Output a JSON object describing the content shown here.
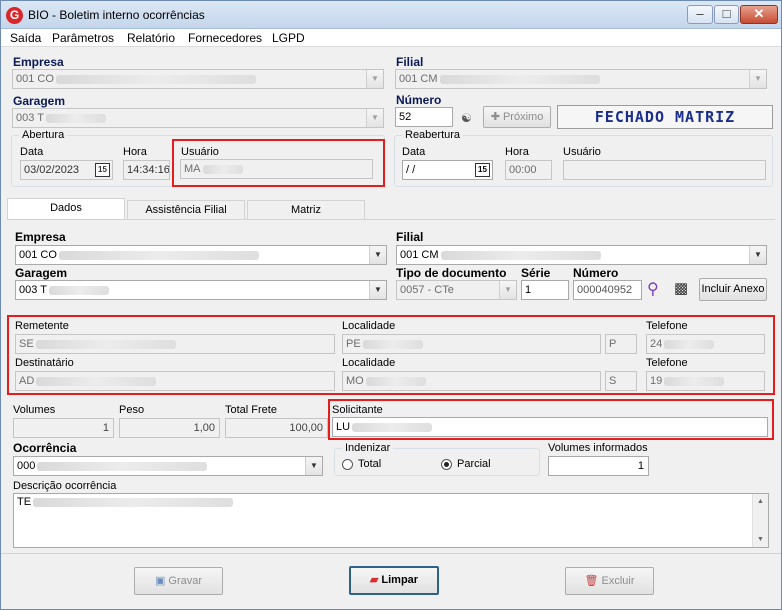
{
  "window": {
    "title": "BIO - Boletim interno ocorrências",
    "icon_letter": "G"
  },
  "menu": [
    "Saída",
    "Parâmetros",
    "Relatório",
    "Fornecedores",
    "LGPD"
  ],
  "header": {
    "empresa_label": "Empresa",
    "empresa_value": "001 CO",
    "filial_label": "Filial",
    "filial_value": "001 CM",
    "garagem_label": "Garagem",
    "garagem_value": "003 T",
    "numero_label": "Número",
    "numero_value": "52",
    "proximo_label": "Próximo",
    "status_text": "FECHADO MATRIZ"
  },
  "abertura": {
    "group_title": "Abertura",
    "data_label": "Data",
    "data_value": "03/02/2023",
    "hora_label": "Hora",
    "hora_value": "14:34:16",
    "usuario_label": "Usuário",
    "usuario_value": "MA"
  },
  "reabertura": {
    "group_title": "Reabertura",
    "data_label": "Data",
    "data_value": " /  /",
    "hora_label": "Hora",
    "hora_value": "00:00",
    "usuario_label": "Usuário",
    "usuario_value": ""
  },
  "calendar_icon_text": "15",
  "tabs": [
    "Dados",
    "Assistência Filial",
    "Matriz"
  ],
  "dados": {
    "empresa_label": "Empresa",
    "empresa_value": "001 CO",
    "filial_label": "Filial",
    "filial_value": "001 CM",
    "garagem_label": "Garagem",
    "garagem_value": "003 T",
    "tipo_doc_label": "Tipo de documento",
    "tipo_doc_value": "0057 - CTe",
    "serie_label": "Série",
    "serie_value": "1",
    "numero_label": "Número",
    "numero_value": "000040952",
    "incluir_anexo_label": "Incluir Anexo",
    "remetente_label": "Remetente",
    "remetente_value": "SE",
    "rem_localidade_label": "Localidade",
    "rem_localidade_value": "PE",
    "rem_uf_value": "P",
    "rem_telefone_label": "Telefone",
    "rem_telefone_value": "24",
    "destinatario_label": "Destinatário",
    "destinatario_value": "AD",
    "dest_localidade_label": "Localidade",
    "dest_localidade_value": "MO",
    "dest_uf_value": "S",
    "dest_telefone_label": "Telefone",
    "dest_telefone_value": "19",
    "volumes_label": "Volumes",
    "volumes_value": "1",
    "peso_label": "Peso",
    "peso_value": "1,00",
    "total_frete_label": "Total Frete",
    "total_frete_value": "100,00",
    "solicitante_label": "Solicitante",
    "solicitante_value": "LU",
    "ocorrencia_label": "Ocorrência",
    "ocorrencia_value": "000",
    "indenizar_title": "Indenizar",
    "indenizar_total": "Total",
    "indenizar_parcial": "Parcial",
    "indenizar_selected": "Parcial",
    "volumes_informados_label": "Volumes informados",
    "volumes_informados_value": "1",
    "descricao_label": "Descrição ocorrência",
    "descricao_value": "TE"
  },
  "footer": {
    "gravar": "Gravar",
    "limpar": "Limpar",
    "excluir": "Excluir"
  },
  "colors": {
    "highlight_border": "#e41d1d",
    "status_text": "#1b2e8c",
    "title_bar": "#c4d6ec"
  }
}
